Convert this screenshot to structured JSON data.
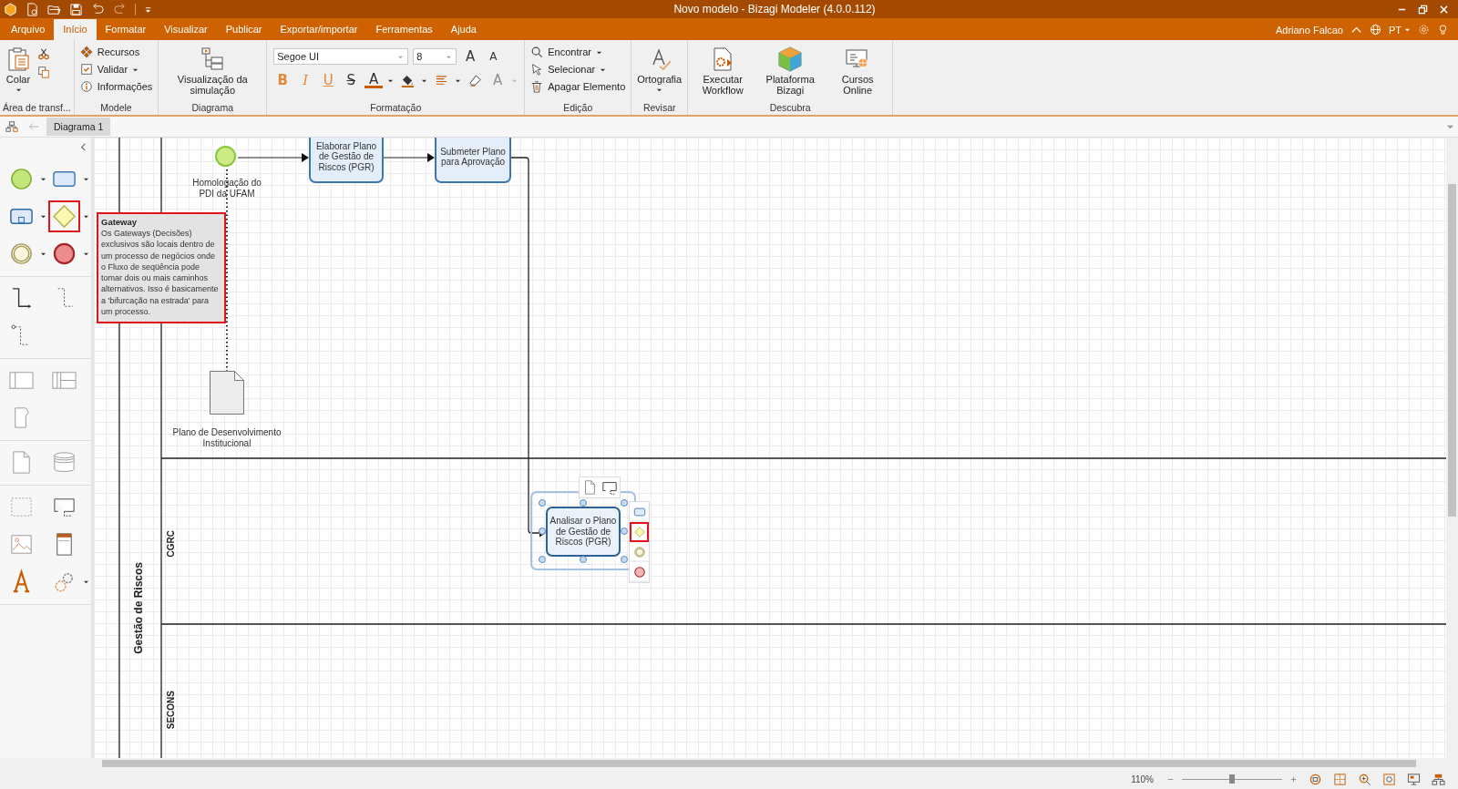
{
  "window": {
    "title": "Novo modelo - Bizagi Modeler (4.0.0.112)"
  },
  "menu": {
    "tabs": [
      {
        "label": "Arquivo",
        "selected": false
      },
      {
        "label": "Início",
        "selected": true
      },
      {
        "label": "Formatar",
        "selected": false
      },
      {
        "label": "Visualizar",
        "selected": false
      },
      {
        "label": "Publicar",
        "selected": false
      },
      {
        "label": "Exportar/importar",
        "selected": false
      },
      {
        "label": "Ferramentas",
        "selected": false
      },
      {
        "label": "Ajuda",
        "selected": false
      }
    ],
    "user": "Adriano Falcao",
    "language": "PT"
  },
  "ribbon": {
    "groups": [
      {
        "kind": "clipboard",
        "label": "Área de transf...",
        "buttons": [
          {
            "label": "Colar"
          }
        ]
      },
      {
        "kind": "list",
        "label": "Modele",
        "buttons": [
          {
            "kind": "resources",
            "label": "Recursos"
          },
          {
            "kind": "validate",
            "label": "Validar"
          },
          {
            "kind": "info",
            "label": "Informações"
          }
        ]
      },
      {
        "kind": "large",
        "label": "Diagrama",
        "buttons": [
          {
            "kind": "simulation",
            "label": "Visualização da simulação"
          }
        ]
      },
      {
        "kind": "format",
        "label": "Formatação",
        "font": "Segoe UI",
        "size": "8",
        "size_tools": [
          {
            "label": "A",
            "kind": "grow"
          },
          {
            "label": "A",
            "kind": "shrink"
          }
        ],
        "tools": [
          {
            "kind": "bold",
            "label": "B",
            "disabled": false
          },
          {
            "kind": "italic",
            "label": "I",
            "disabled": false
          },
          {
            "kind": "underline",
            "label": "U",
            "disabled": false
          },
          {
            "kind": "strike",
            "label": "S",
            "disabled": false
          },
          {
            "kind": "font-color",
            "label": "A",
            "disabled": false
          },
          {
            "kind": "fill",
            "disabled": false
          },
          {
            "kind": "align",
            "disabled": false
          },
          {
            "kind": "clear",
            "disabled": false
          },
          {
            "kind": "text-color",
            "label": "A",
            "disabled": true
          }
        ]
      },
      {
        "kind": "list",
        "label": "Edição",
        "buttons": [
          {
            "kind": "find",
            "label": "Encontrar"
          },
          {
            "kind": "select",
            "label": "Selecionar"
          },
          {
            "kind": "delete",
            "label": "Apagar Elemento"
          }
        ]
      },
      {
        "kind": "large",
        "label": "Revisar",
        "buttons": [
          {
            "kind": "spelling",
            "label": "Ortografia"
          }
        ]
      },
      {
        "kind": "large",
        "label": "Descubra",
        "buttons": [
          {
            "kind": "workflow",
            "label": "Executar Workflow"
          },
          {
            "kind": "platform",
            "label": "Plataforma Bizagi"
          },
          {
            "kind": "courses",
            "label": "Cursos Online"
          }
        ]
      }
    ]
  },
  "doc_tabs": [
    {
      "label": "Diagrama 1",
      "selected": true
    }
  ],
  "palette": {
    "sections": [
      [
        {
          "kind": "start-event",
          "highlighted": false
        },
        {
          "kind": "task",
          "highlighted": false
        },
        {
          "kind": "subprocess",
          "highlighted": false
        },
        {
          "kind": "gateway",
          "highlighted": true
        },
        {
          "kind": "intermediate-event",
          "highlighted": false
        },
        {
          "kind": "end-event",
          "highlighted": false
        }
      ],
      [
        {
          "kind": "sequence-flow",
          "highlighted": false
        },
        {
          "kind": "message-flow",
          "highlighted": false
        },
        {
          "kind": "association",
          "highlighted": false
        }
      ],
      [
        {
          "kind": "pool",
          "highlighted": false
        },
        {
          "kind": "lanes",
          "highlighted": false
        },
        {
          "kind": "milestone",
          "highlighted": false
        }
      ],
      [
        {
          "kind": "data-object",
          "highlighted": false
        },
        {
          "kind": "data-store",
          "highlighted": false
        }
      ],
      [
        {
          "kind": "group",
          "highlighted": false
        },
        {
          "kind": "annotation",
          "highlighted": false
        },
        {
          "kind": "image",
          "highlighted": false
        },
        {
          "kind": "header",
          "highlighted": false
        },
        {
          "kind": "text",
          "highlighted": false
        },
        {
          "kind": "custom",
          "highlighted": false
        }
      ]
    ]
  },
  "diagram": {
    "pool": "Gestão de Riscos",
    "lanes": [
      {
        "label": "CGRC"
      },
      {
        "label": "SECONS"
      }
    ],
    "events": [
      {
        "kind": "start",
        "label": "Homologação do PDI da UFAM"
      }
    ],
    "tasks": [
      {
        "label": "Elaborar Plano de Gestão de Riscos (PGR)",
        "selected": false
      },
      {
        "label": "Submeter Plano para Aprovação",
        "selected": false
      },
      {
        "label": "Analisar o Plano de Gestão de Riscos (PGR)",
        "selected": true
      }
    ],
    "artifacts": [
      {
        "kind": "data-object",
        "label": "Plano de Desenvolvimento Institucional"
      }
    ],
    "tooltip": {
      "title": "Gateway",
      "text": "Os Gateways (Decisões) exclusivos são locais dentro de um processo de negócios onde o Fluxo de seqüência pode tomar dois ou mais caminhos alternativos. Isso é basicamente a 'bifurcação na estrada' para um processo."
    },
    "quick_palette": [
      {
        "kind": "task",
        "highlighted": false
      },
      {
        "kind": "gateway",
        "highlighted": true
      },
      {
        "kind": "intermediate-event",
        "highlighted": false
      },
      {
        "kind": "end-event",
        "highlighted": false
      }
    ]
  },
  "status_bar": {
    "zoom": "110%",
    "level": 0.5
  }
}
